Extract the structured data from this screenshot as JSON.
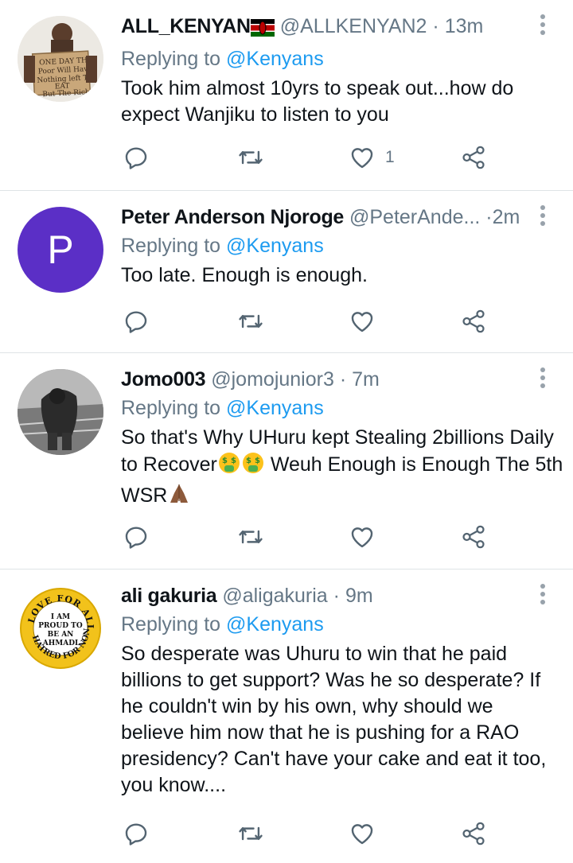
{
  "tweets": [
    {
      "name": "ALL_KENYAN",
      "handle": "@ALLKENYAN2",
      "separator": "·",
      "time": "13m",
      "replying_prefix": "Replying to ",
      "replying_to": "@Kenyans",
      "text": "Took him almost 10yrs to speak out...how do expect Wanjiku to listen to you",
      "like_count": "1",
      "avatar_sign_text": "One Day The Poor Will Have Nothing Left To Eat But The Rich"
    },
    {
      "name": "Peter Anderson Njoroge",
      "handle": "@PeterAnde...",
      "separator": "·",
      "time": "2m",
      "replying_prefix": "Replying to ",
      "replying_to": "@Kenyans",
      "text": "Too late. Enough is enough.",
      "avatar_letter": "P",
      "avatar_color": "#5b2fc6"
    },
    {
      "name": "Jomo003",
      "handle": "@jomojunior3",
      "separator": "·",
      "time": "7m",
      "replying_prefix": "Replying to ",
      "replying_to": "@Kenyans",
      "text_line1": "So that's Why UHuru kept Stealing 2billions Daily",
      "text_line2_a": "to Recover",
      "text_line2_b": " Weuh Enough is Enough The 5th",
      "text_line3": "WSR"
    },
    {
      "name": "ali gakuria",
      "handle": "@aligakuria",
      "separator": "·",
      "time": "9m",
      "replying_prefix": "Replying to ",
      "replying_to": "@Kenyans",
      "text": "So desperate was Uhuru to win that he paid billions to get support? Was he so desperate? If he couldn't win by his own, why should we believe him now that he is pushing for a RAO presidency? Can't have your cake and eat it too, you know....",
      "badge_top": "LOVE FOR ALL",
      "badge_bottom": "HATRED FOR NONE",
      "badge_center": "I AM PROUD TO BE AN AHMADI"
    }
  ],
  "icons": {
    "reply": "reply-icon",
    "retweet": "retweet-icon",
    "like": "heart-icon",
    "share": "share-icon",
    "more": "more-vertical-icon"
  },
  "colors": {
    "text": "#0f1419",
    "secondary": "#657786",
    "link": "#1d9bf0",
    "divider": "#dfe3e6"
  }
}
